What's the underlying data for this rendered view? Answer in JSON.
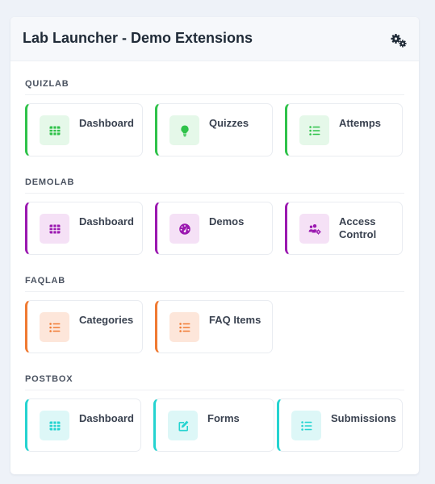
{
  "header": {
    "title": "Lab Launcher - Demo Extensions",
    "settings_icon": "gears-icon"
  },
  "sections": [
    {
      "title": "QUIZLAB",
      "accent": "#2fc24a",
      "tint": "#e5f8e9",
      "cards": [
        {
          "label": "Dashboard",
          "icon": "table-icon"
        },
        {
          "label": "Quizzes",
          "icon": "lightbulb-icon"
        },
        {
          "label": "Attemps",
          "icon": "list-icon"
        }
      ]
    },
    {
      "title": "DEMOLAB",
      "accent": "#9b18b0",
      "tint": "#f5e1f6",
      "cards": [
        {
          "label": "Dashboard",
          "icon": "table-icon"
        },
        {
          "label": "Demos",
          "icon": "gauge-icon"
        },
        {
          "label": "Access\nControl",
          "icon": "users-cog-icon"
        }
      ]
    },
    {
      "title": "FAQLAB",
      "accent": "#f07a32",
      "tint": "#fde6da",
      "cards": [
        {
          "label": "Categories",
          "icon": "list-icon"
        },
        {
          "label": "FAQ Items",
          "icon": "list-icon"
        }
      ]
    },
    {
      "title": "POSTBOX",
      "accent": "#25d3d0",
      "tint": "#ddf7f7",
      "cards": [
        {
          "label": "Dashboard",
          "icon": "table-icon"
        },
        {
          "label": "Forms",
          "icon": "edit-icon"
        },
        {
          "label": "Submissions",
          "icon": "list-icon"
        }
      ]
    }
  ]
}
